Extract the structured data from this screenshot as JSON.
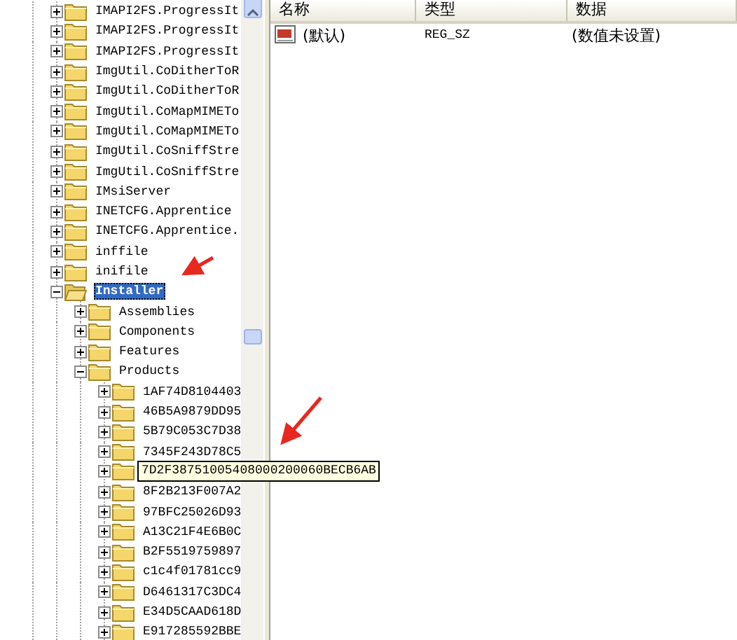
{
  "tree": [
    {
      "label": "IMAPI2FS.ProgressIt",
      "expanded": false,
      "selected": false
    },
    {
      "label": "IMAPI2FS.ProgressIt",
      "expanded": false,
      "selected": false
    },
    {
      "label": "IMAPI2FS.ProgressIt",
      "expanded": false,
      "selected": false
    },
    {
      "label": "ImgUtil.CoDitherToR",
      "expanded": false,
      "selected": false
    },
    {
      "label": "ImgUtil.CoDitherToR",
      "expanded": false,
      "selected": false
    },
    {
      "label": "ImgUtil.CoMapMIMETo",
      "expanded": false,
      "selected": false
    },
    {
      "label": "ImgUtil.CoMapMIMETo",
      "expanded": false,
      "selected": false
    },
    {
      "label": "ImgUtil.CoSniffStre",
      "expanded": false,
      "selected": false
    },
    {
      "label": "ImgUtil.CoSniffStre",
      "expanded": false,
      "selected": false
    },
    {
      "label": "IMsiServer",
      "expanded": false,
      "selected": false
    },
    {
      "label": "INETCFG.Apprentice",
      "expanded": false,
      "selected": false
    },
    {
      "label": "INETCFG.Apprentice.",
      "expanded": false,
      "selected": false
    },
    {
      "label": "inffile",
      "expanded": false,
      "selected": false
    },
    {
      "label": "inifile",
      "expanded": false,
      "selected": false
    },
    {
      "label": "Installer",
      "expanded": true,
      "selected": true,
      "children": [
        {
          "label": "Assemblies",
          "expanded": false,
          "selected": false
        },
        {
          "label": "Components",
          "expanded": false,
          "selected": false
        },
        {
          "label": "Features",
          "expanded": false,
          "selected": false
        },
        {
          "label": "Products",
          "expanded": true,
          "selected": false,
          "children": [
            {
              "label": "1AF74D8104403",
              "expanded": false,
              "selected": false
            },
            {
              "label": "46B5A9879DD95",
              "expanded": false,
              "selected": false
            },
            {
              "label": "5B79C053C7D38",
              "expanded": false,
              "selected": false
            },
            {
              "label": "7345F243D78C5",
              "expanded": false,
              "selected": false
            },
            {
              "tooltip": "7D2F38751005408000200060BECB6AB",
              "expanded": false,
              "selected": false
            },
            {
              "label": "8F2B213F007A2",
              "expanded": false,
              "selected": false
            },
            {
              "label": "97BFC25026D93",
              "expanded": false,
              "selected": false
            },
            {
              "label": "A13C21F4E6B0C",
              "expanded": false,
              "selected": false
            },
            {
              "label": "B2F5519759897",
              "expanded": false,
              "selected": false
            },
            {
              "label": "c1c4f01781cc9",
              "expanded": false,
              "selected": false
            },
            {
              "label": "D6461317C3DC4",
              "expanded": false,
              "selected": false
            },
            {
              "label": "E34D5CAAD618D",
              "expanded": false,
              "selected": false
            },
            {
              "label": "E917285592BBE",
              "expanded": false,
              "selected": false
            }
          ]
        }
      ]
    }
  ],
  "values": {
    "columns": [
      "名称",
      "类型",
      "数据"
    ],
    "rows": [
      {
        "name": "(默认)",
        "type": "REG_SZ",
        "data": "(数值未设置)"
      }
    ]
  }
}
